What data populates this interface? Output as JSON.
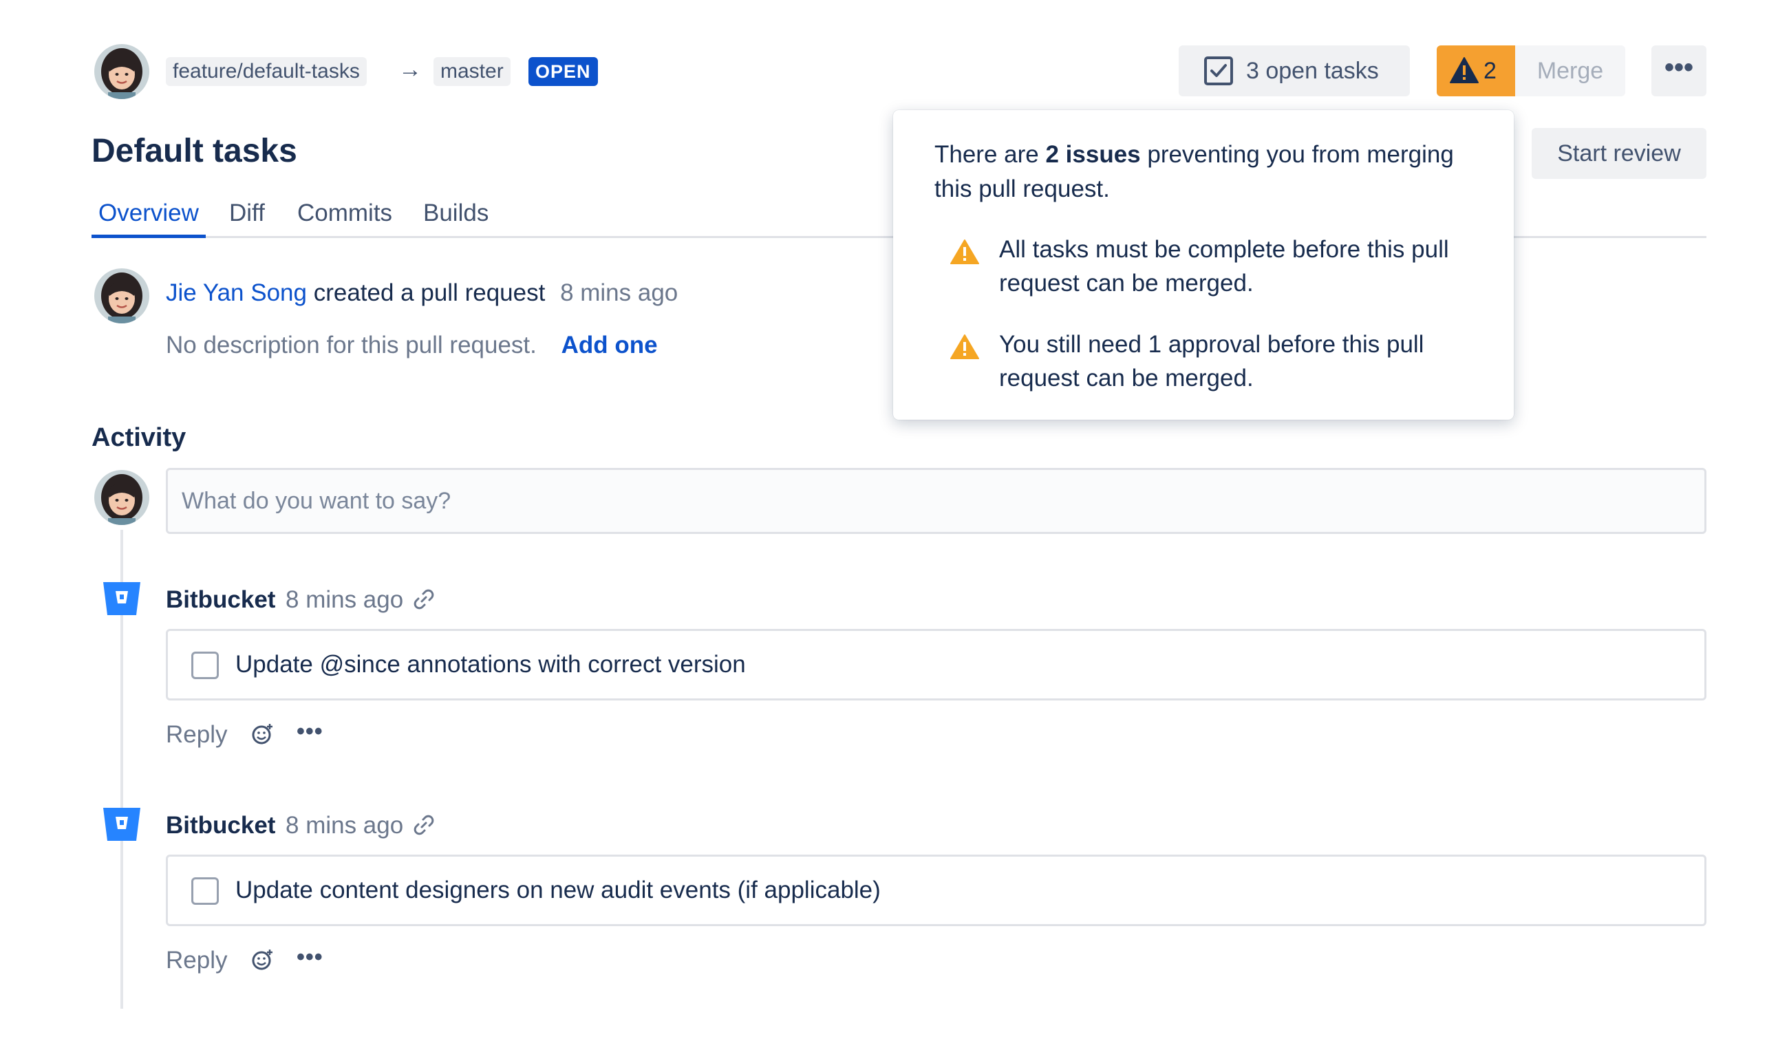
{
  "header": {
    "source_branch": "feature/default-tasks",
    "arrow": "→",
    "target_branch": "master",
    "status": "OPEN",
    "open_tasks_label": "3 open tasks",
    "issues_count": "2",
    "merge_label": "Merge",
    "more_label": "•••",
    "start_review_label": "Start review"
  },
  "title": "Default tasks",
  "tabs": [
    {
      "label": "Overview",
      "active": true
    },
    {
      "label": "Diff"
    },
    {
      "label": "Commits"
    },
    {
      "label": "Builds"
    }
  ],
  "pull_request": {
    "author": "Jie Yan Song",
    "action": "created a pull request",
    "time": "8 mins ago",
    "description": "No description for this pull request.",
    "add_link": "Add one"
  },
  "activity": {
    "heading": "Activity",
    "comment_placeholder": "What do you want to say?",
    "items": [
      {
        "author": "Bitbucket",
        "time": "8 mins ago",
        "task": "Update @since annotations with correct version",
        "reply": "Reply",
        "more": "•••"
      },
      {
        "author": "Bitbucket",
        "time": "8 mins ago",
        "task": "Update content designers on new audit events (if applicable)",
        "reply": "Reply",
        "more": "•••"
      }
    ]
  },
  "popover": {
    "prefix": "There are ",
    "bold": "2 issues",
    "suffix": " preventing you from merging this pull request.",
    "issues": [
      "All tasks must be complete before this pull request can be merged.",
      "You still need 1 approval before this pull request can be merged."
    ]
  },
  "icons": {
    "avatar": "avatar",
    "checkbox": "checkbox-checked-icon",
    "warning": "warning-icon",
    "bitbucket": "bitbucket-logo",
    "link": "link-icon",
    "emoji": "emoji-add-icon"
  },
  "colors": {
    "primary": "#0c52cc",
    "warning": "#f5a030",
    "text": "#172b4d",
    "muted": "#6b778c",
    "bitbucket": "#2684ff"
  }
}
